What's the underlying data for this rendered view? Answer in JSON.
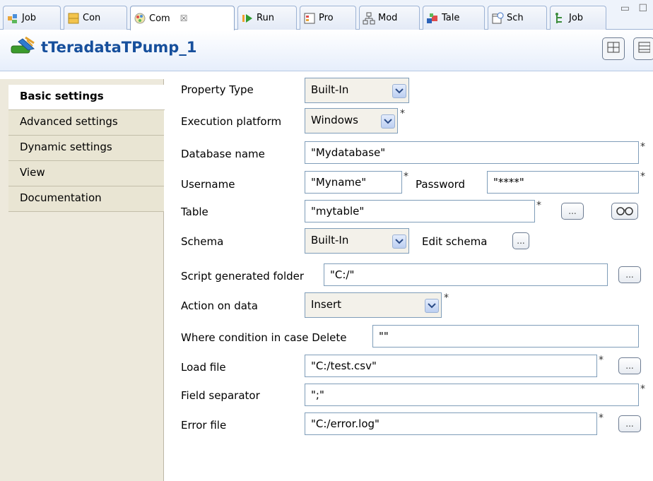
{
  "tabs": [
    {
      "label": "Job",
      "icon": "job-icon"
    },
    {
      "label": "Con",
      "icon": "contexts-icon"
    },
    {
      "label": "Com",
      "icon": "component-icon",
      "close": "☒"
    },
    {
      "label": "Run",
      "icon": "run-icon"
    },
    {
      "label": "Pro",
      "icon": "problems-icon"
    },
    {
      "label": "Mod",
      "icon": "modules-icon"
    },
    {
      "label": "Tale",
      "icon": "talend-icon"
    },
    {
      "label": "Sch",
      "icon": "scheduler-icon"
    },
    {
      "label": "Job",
      "icon": "job-hierarchy-icon"
    }
  ],
  "window_controls": {
    "minimize": "▭",
    "maximize": "☐"
  },
  "component": {
    "title": "tTeradataTPump_1",
    "icon": "teradata-component-icon"
  },
  "nav": [
    "Basic settings",
    "Advanced settings",
    "Dynamic settings",
    "View",
    "Documentation"
  ],
  "form": {
    "property_type": {
      "label": "Property Type",
      "value": "Built-In"
    },
    "execution_platform": {
      "label": "Execution platform",
      "value": "Windows"
    },
    "database_name": {
      "label": "Database name",
      "value": "\"Mydatabase\""
    },
    "username": {
      "label": "Username",
      "value": "\"Myname\""
    },
    "password": {
      "label": "Password",
      "value": "\"****\""
    },
    "table": {
      "label": "Table",
      "value": "\"mytable\""
    },
    "schema": {
      "label": "Schema",
      "value": "Built-In",
      "edit_label": "Edit schema"
    },
    "script_folder": {
      "label": "Script generated folder",
      "value": "\"C:/\""
    },
    "action": {
      "label": "Action on data",
      "value": "Insert"
    },
    "where_condition": {
      "label": "Where condition in case Delete",
      "value": "\"\""
    },
    "load_file": {
      "label": "Load file",
      "value": "\"C:/test.csv\""
    },
    "field_separator": {
      "label": "Field separator",
      "value": "\";\""
    },
    "error_file": {
      "label": "Error file",
      "value": "\"C:/error.log\""
    },
    "required_mark": "*",
    "browse_label": "..."
  },
  "colors": {
    "accent": "#164f9c",
    "nav_bg": "#ede9dc",
    "tab_bg": "#eef3fb"
  }
}
